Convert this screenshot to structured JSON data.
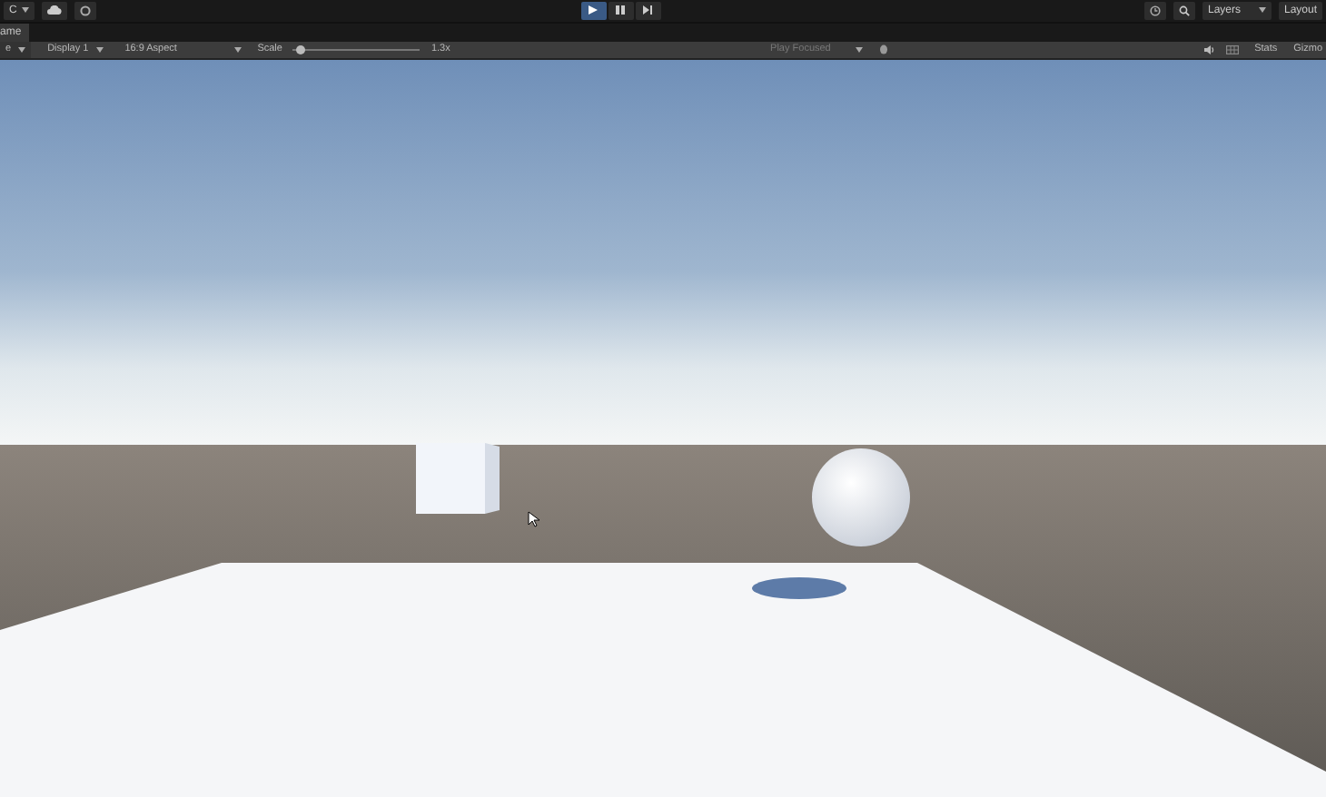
{
  "toolbar": {
    "account": "C",
    "play_controls": [
      {
        "kind": "play",
        "selected": true
      },
      {
        "kind": "pause",
        "selected": false
      },
      {
        "kind": "step",
        "selected": false
      }
    ],
    "layers": "Layers",
    "layout": "Layout"
  },
  "tab": {
    "label": "ame"
  },
  "game_bar": {
    "view": "e",
    "display": "Display 1",
    "aspect": "16:9 Aspect",
    "scale_label": "Scale",
    "scale": {
      "level": 0.03,
      "reading": "1.3x"
    },
    "play_mode": "Play Focused",
    "stats": "Stats",
    "gizmos": "Gizmo"
  }
}
